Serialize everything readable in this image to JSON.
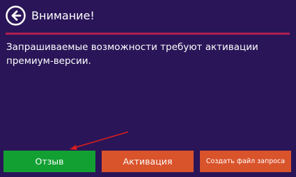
{
  "dialog": {
    "title": "Внимание!",
    "back_icon": "arrow-left-circle-icon",
    "message": "Запрашиваемые возможности требуют активации премиум-версии."
  },
  "buttons": {
    "review_label": "Отзыв",
    "activate_label": "Активация",
    "request_file_label": "Создать файл запроса"
  },
  "annotation": {
    "arrow_icon": "red-pointer-arrow",
    "color": "#d81e1e"
  },
  "colors": {
    "background": "#2a1558",
    "divider": "#b0204e",
    "review_button": "#12a032",
    "action_button": "#d9532b"
  }
}
